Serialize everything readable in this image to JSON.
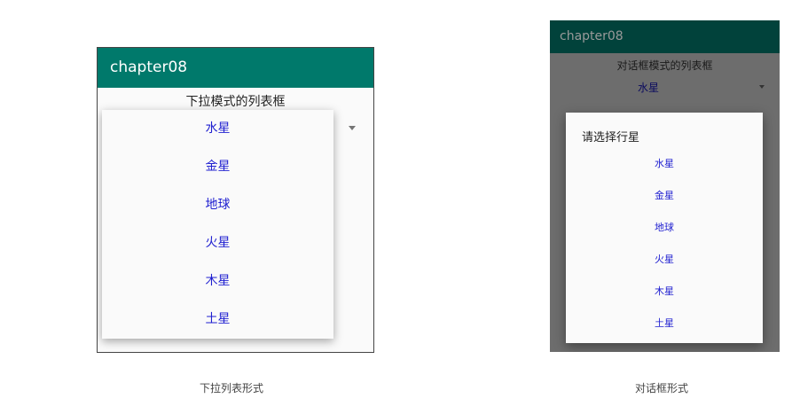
{
  "left": {
    "app_title": "chapter08",
    "spinner_label": "下拉模式的列表框",
    "items": [
      "水星",
      "金星",
      "地球",
      "火星",
      "木星",
      "土星"
    ],
    "caption": "下拉列表形式"
  },
  "right": {
    "app_title": "chapter08",
    "spinner_label": "对话框模式的列表框",
    "selected_value": "水星",
    "dialog_title": "请选择行星",
    "items": [
      "水星",
      "金星",
      "地球",
      "火星",
      "木星",
      "土星"
    ],
    "caption": "对话框形式"
  },
  "colors": {
    "appbar_left": "#00796b",
    "appbar_right": "#01423b",
    "item_text": "#1f1fd0"
  }
}
